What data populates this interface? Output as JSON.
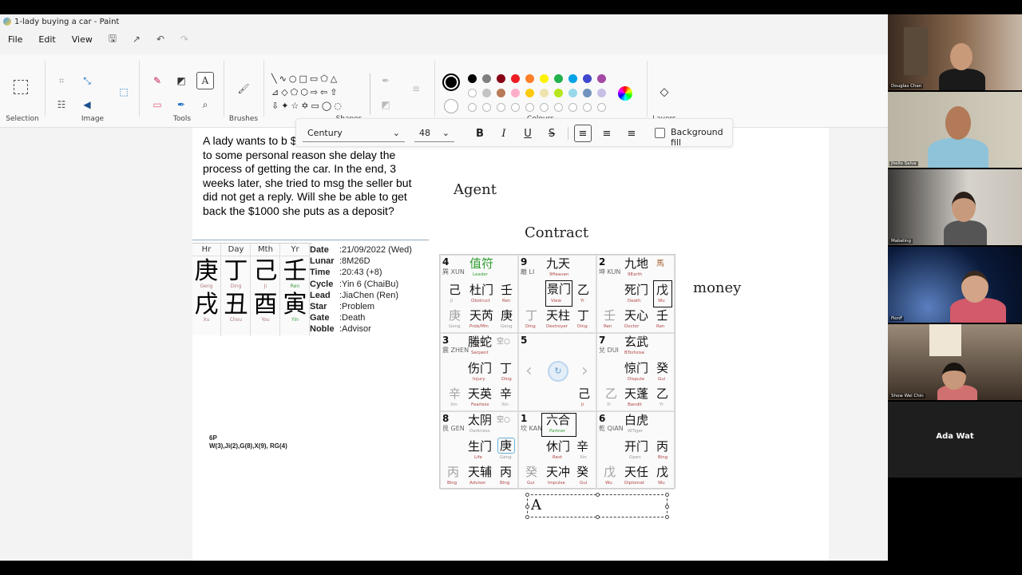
{
  "window": {
    "title": "1-lady buying a car - Paint"
  },
  "menu": {
    "file": "File",
    "edit": "Edit",
    "view": "View"
  },
  "ribbon": {
    "groups": {
      "selection": "Selection",
      "image": "Image",
      "tools": "Tools",
      "brushes": "Brushes",
      "shapes": "Shapes",
      "colours": "Colours",
      "layers": "Layers"
    },
    "palette_row1": [
      "#000000",
      "#7f7f7f",
      "#880015",
      "#ed1c24",
      "#ff7f27",
      "#fff200",
      "#22b14c",
      "#00a2e8",
      "#3f48cc",
      "#a349a4"
    ],
    "palette_row2": [
      "#ffffff",
      "#c3c3c3",
      "#b97a57",
      "#ffaec9",
      "#ffc90e",
      "#efe4b0",
      "#b5e61d",
      "#99d9ea",
      "#7092be",
      "#c8bfe7"
    ],
    "active_colour": "#000000"
  },
  "text_toolbar": {
    "font": "Century",
    "size": "48",
    "background_fill": "Background fill"
  },
  "canvas": {
    "question": "A lady wants to b $1000 as deposit, and due to some personal reason she delay the process of getting the car. In the end,  3 weeks later, she tried to msg the seller but did not get a reply. Will she be able to get back the $1000 she puts as a deposit?",
    "pillars": {
      "headers": [
        "Hr",
        "Day",
        "Mth",
        "Yr"
      ],
      "stems": [
        "庚",
        "丁",
        "己",
        "壬"
      ],
      "stem_subs": [
        "Geng",
        "Ding",
        "Ji",
        "Ren"
      ],
      "branches": [
        "戌",
        "丑",
        "酉",
        "寅"
      ],
      "branch_subs": [
        "Xu",
        "Chou",
        "You",
        "Yin"
      ]
    },
    "info": [
      {
        "k": "Date",
        "v": ":21/09/2022 (Wed)"
      },
      {
        "k": "Lunar",
        "v": ":8M26D"
      },
      {
        "k": "Time",
        "v": ":20:43 (+8)"
      },
      {
        "k": "Cycle",
        "v": ":Yin 6 (ChaiBu)"
      },
      {
        "k": "Lead",
        "v": ":JiaChen (Ren)"
      },
      {
        "k": "Star",
        "v": ":Problem"
      },
      {
        "k": "Gate",
        "v": ":Death"
      },
      {
        "k": "Noble",
        "v": ":Advisor"
      }
    ],
    "pattern_line1": "6P",
    "pattern_line2": "W(3),Ji(2),G(8),X(9), RG(4)",
    "label_agent": "Agent",
    "label_contract": "Contract",
    "label_money": "money",
    "textbox_glyph": "A"
  },
  "palaces": {
    "p4": {
      "num": "4",
      "dir": "巽 XUN",
      "deity": "值符",
      "deity_sub": "Leader",
      "gate": "杜门",
      "gate_sub": "Obstruct",
      "star": "天芮",
      "star_sub": "Prob/Min",
      "l1": "己",
      "l1s": "Ji",
      "r1": "壬",
      "r1s": "Ren",
      "l2": "庚",
      "l2s": "Geng",
      "r2": "庚",
      "r2s": "Geng"
    },
    "p9": {
      "num": "9",
      "dir": "離 LI",
      "deity": "九天",
      "deity_sub": "9Heaven",
      "gate": "景门",
      "gate_sub": "View",
      "star": "天柱",
      "star_sub": "Destroyer",
      "r1": "乙",
      "r1s": "Yi",
      "l2": "丁",
      "l2s": "Ding",
      "r2": "丁",
      "r2s": "Ding"
    },
    "p2": {
      "num": "2",
      "dir": "坤 KUN",
      "deity": "九地",
      "deity_sub": "9Earth",
      "gate": "死门",
      "gate_sub": "Death",
      "star": "天心",
      "star_sub": "Doctor",
      "r1": "戊",
      "r1s": "Wu",
      "l2": "壬",
      "l2s": "Ren",
      "r2": "壬",
      "r2s": "Ren"
    },
    "p3": {
      "num": "3",
      "dir": "震 ZHEN",
      "deity": "螣蛇",
      "deity_sub": "Serpent",
      "gate": "伤门",
      "gate_sub": "Injury",
      "star": "天英",
      "star_sub": "Fearless",
      "r1": "丁",
      "r1s": "Ding",
      "l2": "辛",
      "l2s": "Xin",
      "r2": "辛",
      "r2s": "Xin"
    },
    "p5": {
      "num": "5",
      "r": "己",
      "rs": "Ji"
    },
    "p7": {
      "num": "7",
      "dir": "兌 DUI",
      "deity": "玄武",
      "deity_sub": "BTortoise",
      "gate": "惊门",
      "gate_sub": "Dispute",
      "star": "天蓬",
      "star_sub": "Bandit",
      "r1": "癸",
      "r1s": "Gui",
      "l2": "乙",
      "l2s": "Yi",
      "r2": "乙",
      "r2s": "Yi"
    },
    "p8": {
      "num": "8",
      "dir": "艮 GEN",
      "deity": "太阴",
      "deity_sub": "Darkness",
      "gate": "生门",
      "gate_sub": "Life",
      "star": "天辅",
      "star_sub": "Advisor",
      "r1": "庚",
      "r1s": "Geng",
      "l2": "丙",
      "l2s": "Bing",
      "r2": "丙",
      "r2s": "Bing"
    },
    "p1": {
      "num": "1",
      "dir": "坎 KAN",
      "deity": "六合",
      "deity_sub": "Partner",
      "gate": "休门",
      "gate_sub": "Rest",
      "star": "天冲",
      "star_sub": "Impulse",
      "r1": "辛",
      "r1s": "Xin",
      "l2": "癸",
      "l2s": "Gui",
      "r2": "癸",
      "r2s": "Gui"
    },
    "p6": {
      "num": "6",
      "dir": "乾 QIAN",
      "deity": "白虎",
      "deity_sub": "WTiger",
      "gate": "开门",
      "gate_sub": "Open",
      "star": "天任",
      "star_sub": "Diplomat",
      "r1": "丙",
      "r1s": "Bing",
      "l2": "戊",
      "l2s": "Wu",
      "r2": "戊",
      "r2s": "Wu"
    }
  },
  "participants": [
    {
      "name": "Douglas Chan"
    },
    {
      "name": "Jhello Salva"
    },
    {
      "name": "Mabeling"
    },
    {
      "name": "FionF"
    },
    {
      "name": "Show Wei Chin"
    },
    {
      "name": "Ada Wat"
    }
  ]
}
